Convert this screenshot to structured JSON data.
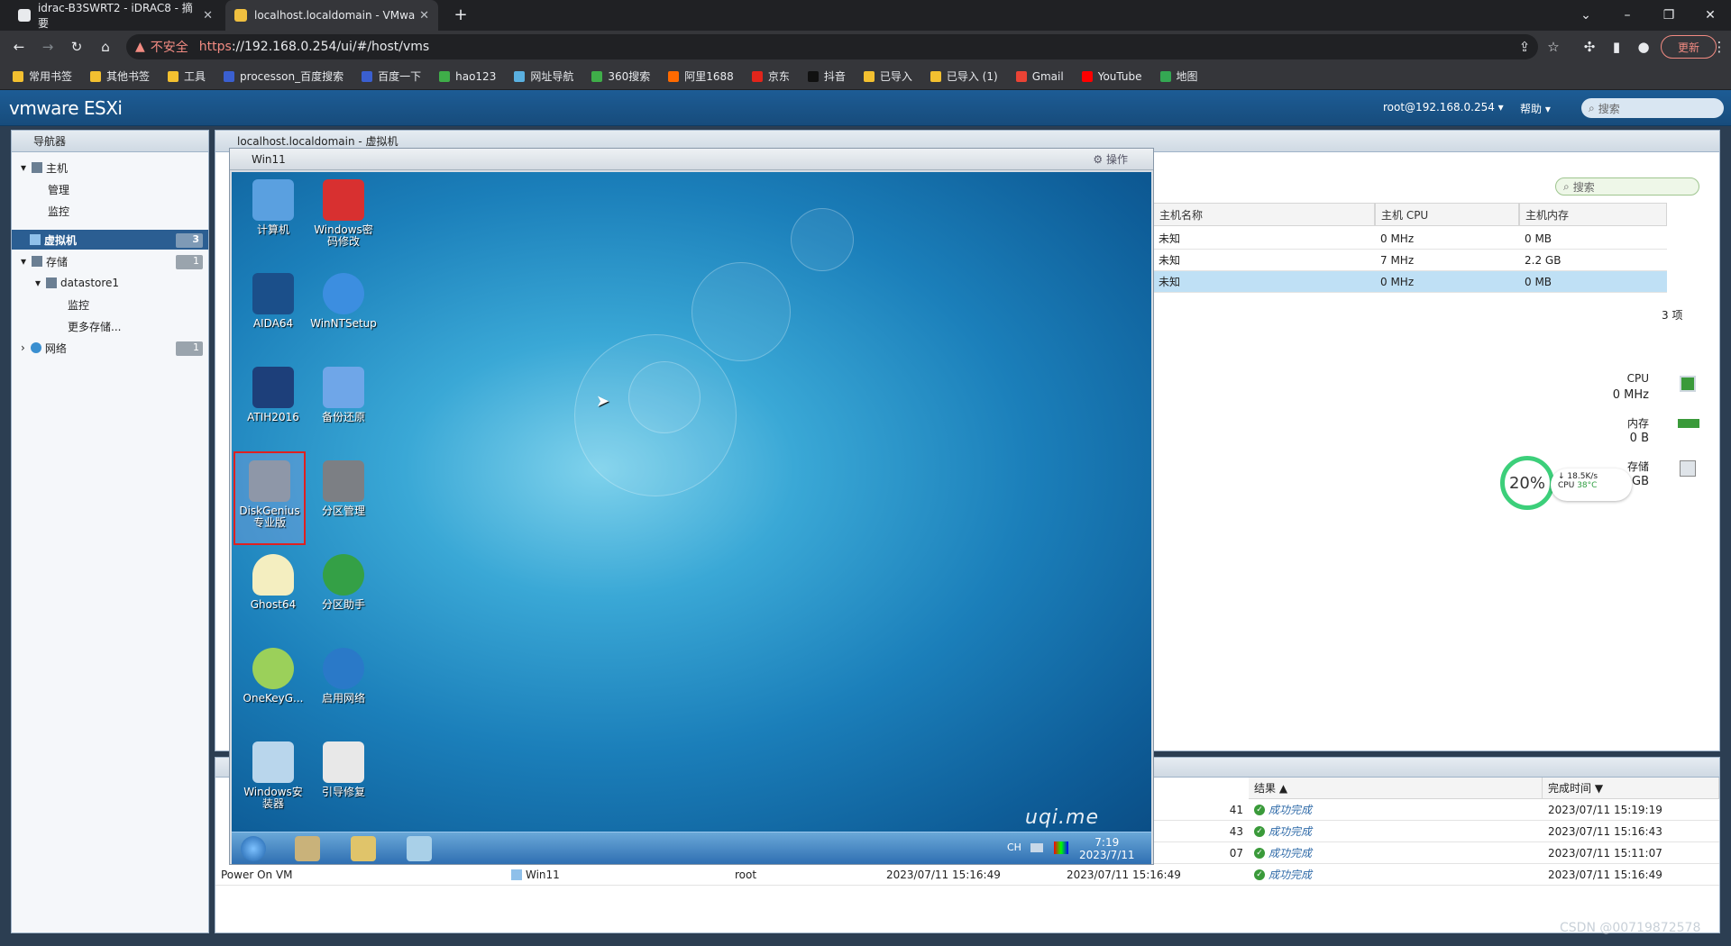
{
  "browser": {
    "tabs": [
      {
        "title": "idrac-B3SWRT2 - iDRAC8 - 摘要"
      },
      {
        "title": "localhost.localdomain - VMwa"
      }
    ],
    "url_insecure": "不安全",
    "url_https": "https",
    "url_rest": "://192.168.0.254/ui/#/host/vms",
    "update_label": "更新",
    "bookmarks": [
      "常用书签",
      "其他书签",
      "工具",
      "processon_百度搜索",
      "百度一下",
      "hao123",
      "网址导航",
      "360搜索",
      "阿里1688",
      "京东",
      "抖音",
      "已导入",
      "已导入 (1)",
      "Gmail",
      "YouTube",
      "地图"
    ]
  },
  "esxi": {
    "logo_vm": "vm",
    "logo_ware": "ware",
    "logo_product": " ESXi",
    "user_menu": "root@192.168.0.254 ▾",
    "help_menu": "帮助 ▾",
    "search_placeholder": "搜索"
  },
  "navigator": {
    "title": "导航器",
    "items": [
      {
        "label": "主机"
      },
      {
        "label": "管理"
      },
      {
        "label": "监控"
      },
      {
        "label": "虚拟机",
        "badge": "3"
      },
      {
        "label": "存储",
        "badge": "1"
      },
      {
        "label": "datastore1"
      },
      {
        "label": "监控"
      },
      {
        "label": "更多存储..."
      },
      {
        "label": "网络",
        "badge": "1"
      }
    ]
  },
  "main": {
    "title": "localhost.localdomain - 虚拟机",
    "search_placeholder": "搜索",
    "columns": [
      "主机名称",
      "主机 CPU",
      "主机内存"
    ],
    "rows": [
      [
        "未知",
        "0 MHz",
        "0 MB"
      ],
      [
        "未知",
        "7 MHz",
        "2.2 GB"
      ],
      [
        "未知",
        "0 MHz",
        "0 MB"
      ]
    ],
    "count": "3 项",
    "resources": {
      "cpu_label": "CPU",
      "cpu_value": "0 MHz",
      "mem_label": "内存",
      "mem_value": "0 B",
      "storage_label": "存储",
      "storage_value": "08 GB"
    }
  },
  "overlay": {
    "gauge": "20%",
    "net_speed": "18.5K/s",
    "cpu_temp_label": "CPU",
    "cpu_temp": "38°C"
  },
  "console": {
    "title": "Win11",
    "actions": "操作",
    "icons": [
      {
        "label": "计算机",
        "color": "#5aa0e0"
      },
      {
        "label": "Windows密码修改",
        "color": "#d83030"
      },
      {
        "label": "AIDA64",
        "color": "#1b4f8a"
      },
      {
        "label": "WinNTSetup",
        "color": "#3c8ee0"
      },
      {
        "label": "ATIH2016",
        "color": "#1d3f7a"
      },
      {
        "label": "备份还原",
        "color": "#6fa6e8"
      },
      {
        "label": "DiskGenius专业版",
        "color": "#8e97a8"
      },
      {
        "label": "分区管理",
        "color": "#7c7f84"
      },
      {
        "label": "Ghost64",
        "color": "#f4eec0"
      },
      {
        "label": "分区助手",
        "color": "#34a046"
      },
      {
        "label": "OneKeyG...",
        "color": "#9bd05a"
      },
      {
        "label": "启用网络",
        "color": "#2a79c8"
      },
      {
        "label": "Windows安装器",
        "color": "#b9d6ec"
      },
      {
        "label": "引导修复",
        "color": "#e8e8e8"
      }
    ],
    "watermark": "uqi.me",
    "tray_lang": "CH",
    "clock_time": "7:19",
    "clock_date": "2023/7/11"
  },
  "tasks": {
    "columns": [
      "结果 ▲",
      "完成时间 ▼"
    ],
    "rows": [
      {
        "task": "",
        "target": "",
        "initiator": "",
        "queued": "",
        "started": "41",
        "result": "成功完成",
        "completed": "2023/07/11 15:19:19"
      },
      {
        "task": "",
        "target": "",
        "initiator": "",
        "queued": "",
        "started": "43",
        "result": "成功完成",
        "completed": "2023/07/11 15:16:43"
      },
      {
        "task": "",
        "target": "",
        "initiator": "",
        "queued": "",
        "started": "07",
        "result": "成功完成",
        "completed": "2023/07/11 15:11:07"
      },
      {
        "task": "Power On VM",
        "target": "Win11",
        "initiator": "root",
        "queued": "2023/07/11 15:16:49",
        "started": "2023/07/11 15:16:49",
        "result": "成功完成",
        "completed": "2023/07/11 15:16:49"
      }
    ]
  },
  "watermark_footer": "CSDN @00719872578"
}
